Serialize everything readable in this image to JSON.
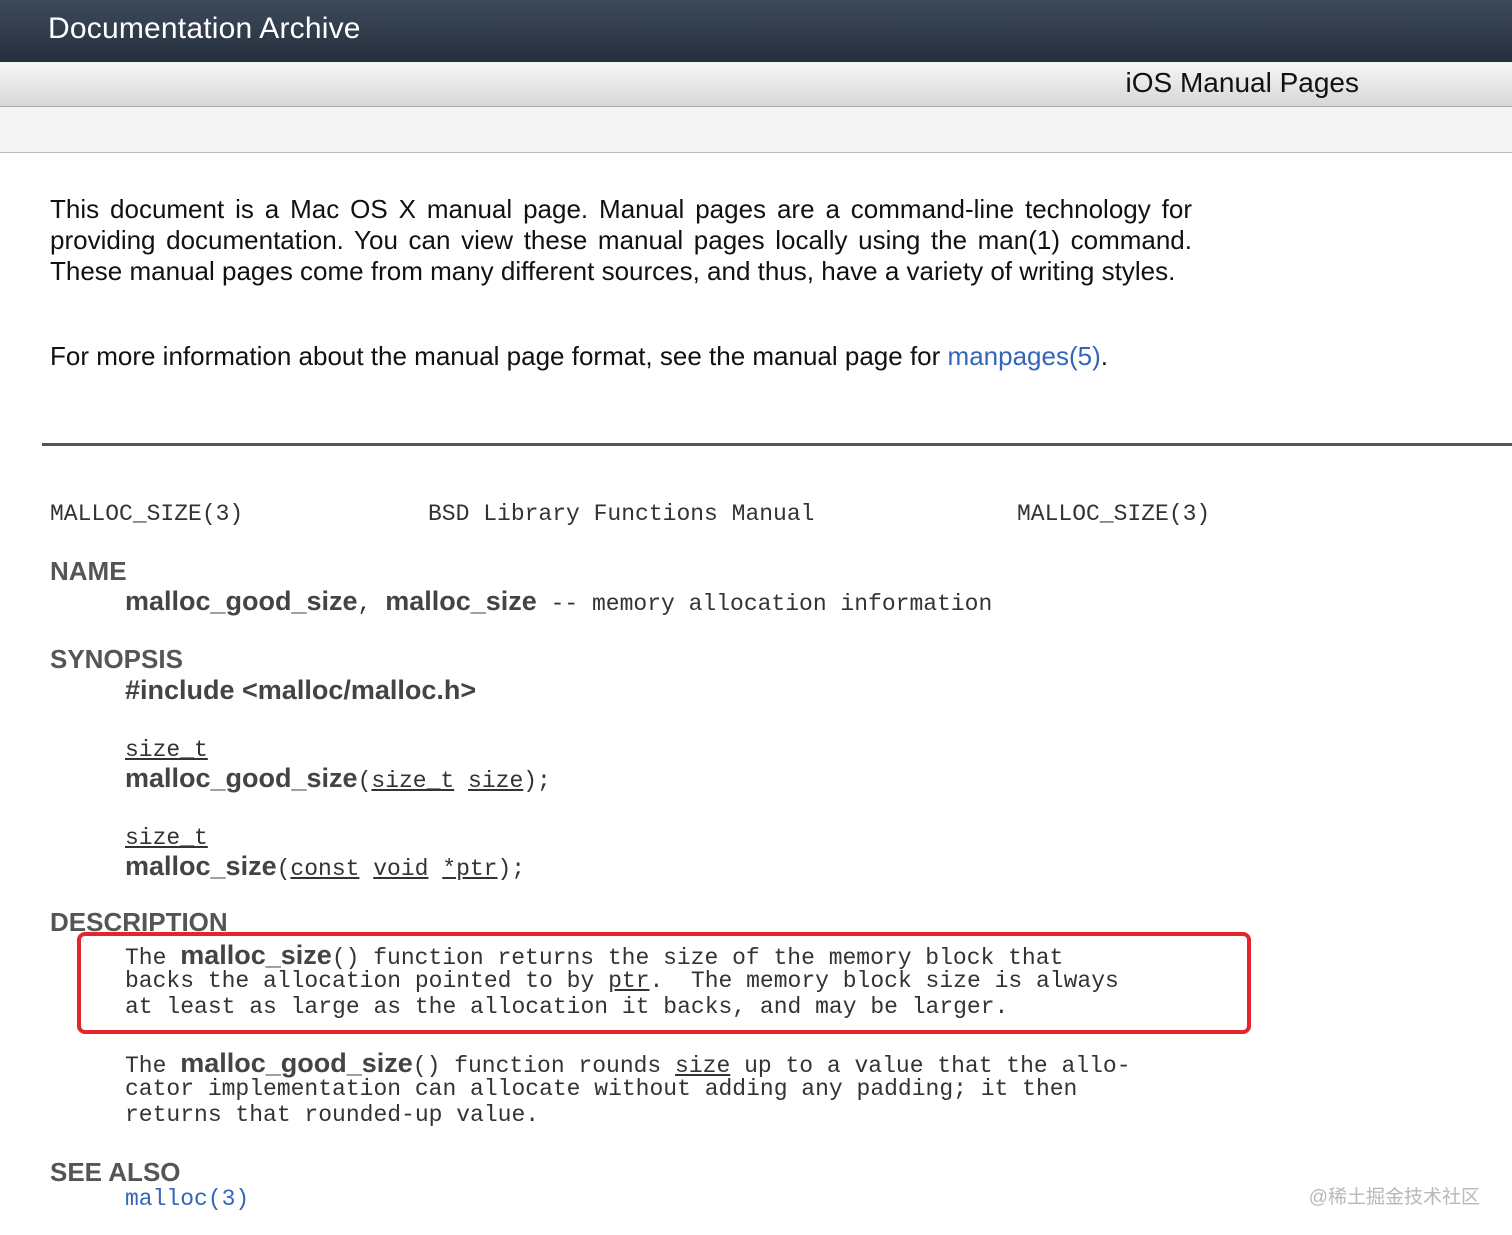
{
  "header": {
    "title": "Documentation Archive",
    "subtitle": "iOS Manual Pages"
  },
  "intro": {
    "p1": "This document is a Mac OS X manual page. Manual pages are a command-line technology for providing documentation. You can view these manual pages locally using the man(1) command. These manual pages come from many different sources, and thus, have a variety of writing styles.",
    "p2_text": "For more information about the manual page format, see the manual page for",
    "p2_link": "manpages(5)",
    "p2_end": "."
  },
  "manpage": {
    "header_left": "MALLOC_SIZE(3)",
    "header_center": "BSD Library Functions Manual",
    "header_right": "MALLOC_SIZE(3)",
    "name": {
      "heading": "NAME",
      "func1": "malloc_good_size",
      "sep": ", ",
      "func2": "malloc_size",
      "desc": " -- memory allocation information"
    },
    "synopsis": {
      "heading": "SYNOPSIS",
      "include": "#include <malloc/malloc.h>",
      "sig1_type": "size_t",
      "sig1_name": "malloc_good_size",
      "sig1_open": "(",
      "sig1_arg_type": "size_t",
      "sig1_arg": "size",
      "sig1_close": ");",
      "sig2_type": "size_t",
      "sig2_name": "malloc_size",
      "sig2_open": "(",
      "sig2_arg_const": "const",
      "sig2_arg_void": "void",
      "sig2_arg_ptr": "*ptr",
      "sig2_close": ");"
    },
    "description": {
      "heading": "DESCRIPTION",
      "p1_l1_pre": "The ",
      "p1_l1_func": "malloc_size",
      "p1_l1_post": "() function returns the size of the memory block that",
      "p1_l2_pre": "backs the allocation pointed to by ",
      "p1_l2_arg": "ptr",
      "p1_l2_post": ".  The memory block size is always",
      "p1_l3": "at least as large as the allocation it backs, and may be larger.",
      "p2_l1_pre": "The ",
      "p2_l1_func": "malloc_good_size",
      "p2_l1_mid": "() function rounds ",
      "p2_l1_arg": "size",
      "p2_l1_post": " up to a value that the allo-",
      "p2_l2": "cator implementation can allocate without adding any padding; it then",
      "p2_l3": "returns that rounded-up value."
    },
    "see_also": {
      "heading": "SEE ALSO",
      "link": "malloc(3)"
    }
  },
  "watermark": "@稀土掘金技术社区",
  "colors": {
    "highlight_border": "#e3262b",
    "link": "#3366bb",
    "topbar": "#2f3846"
  }
}
